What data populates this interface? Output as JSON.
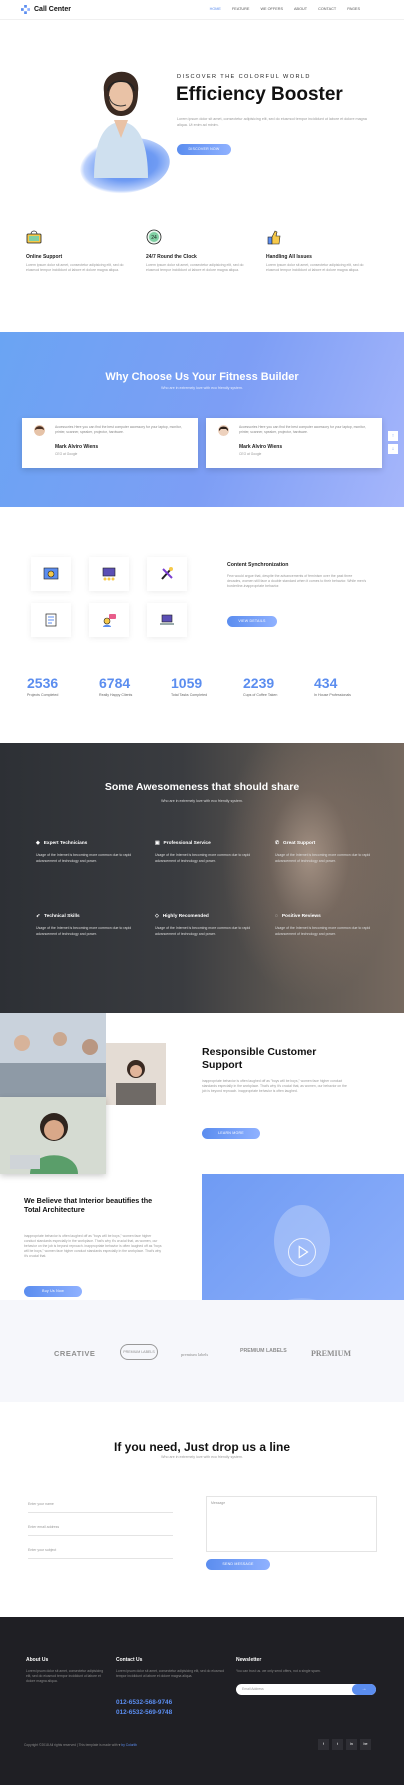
{
  "header": {
    "logo": "Call Center",
    "nav": [
      "HOME",
      "FEATURE",
      "WE OFFERS",
      "ABOUT",
      "CONTACT",
      "PAGES"
    ]
  },
  "hero": {
    "eyebrow": "DISCOVER THE COLORFUL WORLD",
    "title": "Efficiency Booster",
    "text": "Lorem ipsum dolor sit amet, consectetur adipisicing elit, sed do eiusmod tempor incididunt ut labore et dolore magna aliqua. Ut enim ad minim.",
    "button": "DISCOVER NOW"
  },
  "features": [
    {
      "title": "Online Support",
      "text": "Lorem ipsum dolor sit amet, consectetur adipisicing elit, sed do eiusmod tempor incididunt ut labore et dolore magna aliqua."
    },
    {
      "title": "24/7 Round the Clock",
      "text": "Lorem ipsum dolor sit amet, consectetur adipisicing elit, sed do eiusmod tempor incididunt ut labore et dolore magna aliqua."
    },
    {
      "title": "Handling All Issues",
      "text": "Lorem ipsum dolor sit amet, consectetur adipisicing elit, sed do eiusmod tempor incididunt ut labore et dolore magna aliqua."
    }
  ],
  "why": {
    "title": "Why Choose Us Your Fitness Builder",
    "subtitle": "Who are in extremely love with eco friendly system.",
    "cards": [
      {
        "quote": "Accessories Here you can find the best computer accessory for your laptop, monitor, printer, scanner, speaker, projector, hardware.",
        "name": "Mark Alviro Wiens",
        "role": "CEO at Google"
      },
      {
        "quote": "Accessories Here you can find the best computer accessory for your laptop, monitor, printer, scanner, speaker, projector, hardware.",
        "name": "Mark Alviro Wiens",
        "role": "CEO at Google"
      }
    ]
  },
  "services": {
    "title": "Content Synchronization",
    "text": "Few would argue that, despite the advancements of feminism over the past three decades, women still face a double standard when it comes to their behavior. While men's borderline-inappropriate behavior.",
    "button": "VIEW DETAILS",
    "stats": [
      {
        "value": "2536",
        "label": "Projects Completed"
      },
      {
        "value": "6784",
        "label": "Really Happy Clients"
      },
      {
        "value": "1059",
        "label": "Total Tasks Completed"
      },
      {
        "value": "2239",
        "label": "Cups of Coffee Taken"
      },
      {
        "value": "434",
        "label": "In House Professionals"
      }
    ]
  },
  "awesome": {
    "title": "Some Awesomeness that should share",
    "subtitle": "Who are in extremely love with eco friendly system.",
    "items": [
      {
        "icon": "user-icon",
        "title": "Expert Technicians",
        "text": "Usage of the Internet is becoming more common due to rapid advancement of technology and power."
      },
      {
        "icon": "license-icon",
        "title": "Professional Service",
        "text": "Usage of the Internet is becoming more common due to rapid advancement of technology and power."
      },
      {
        "icon": "phone-icon",
        "title": "Great Support",
        "text": "Usage of the Internet is becoming more common due to rapid advancement of technology and power."
      },
      {
        "icon": "rocket-icon",
        "title": "Technical Skills",
        "text": "Usage of the Internet is becoming more common due to rapid advancement of technology and power."
      },
      {
        "icon": "diamond-icon",
        "title": "Highly Recomended",
        "text": "Usage of the Internet is becoming more common due to rapid advancement of technology and power."
      },
      {
        "icon": "bubble-icon",
        "title": "Positive Reviews",
        "text": "Usage of the Internet is becoming more common due to rapid advancement of technology and power."
      }
    ]
  },
  "responsible": {
    "title": "Responsible Customer Support",
    "text": "inappropriate behavior is often laughed off as \"boys will be boys,\" women face higher conduct standards especially in the workplace. That's why it's crucial that, as women, our behavior on the job is beyond reproach. inappropriate behavior is often laughed.",
    "button": "LEARN MORE"
  },
  "believe": {
    "title": "We Believe that Interior beautifies the Total Architecture",
    "text": "inappropriate behavior is often laughed off as \"boys will be boys,\" women face higher conduct standards especially in the workplace. That's why it's crucial that, as women, our behavior on the job is beyond reproach. inappropriate behavior is often laughed off as \"boys will be boys,\" women face higher conduct standards especially in the workplace. That's why it's crucial that.",
    "button": "Buy Us Now"
  },
  "logos": [
    "CREATIVE",
    "PREMIUM LABELS",
    "premium labels",
    "PREMIUM LABELS",
    "PREMIUM"
  ],
  "contact": {
    "title": "If you need, Just drop us a line",
    "subtitle": "Who are in extremely love with eco friendly system.",
    "name_placeholder": "Enter your name",
    "email_placeholder": "Enter email address",
    "subject_placeholder": "Enter your subject",
    "message_placeholder": "Message",
    "button": "SEND MESSAGE"
  },
  "footer": {
    "about_title": "About Us",
    "about_text": "Lorem ipsum dolor sit amet, consectetur adipisicing elit, sed do eiusmod tempor incididunt ut labore et dolore magna aliqua.",
    "contact_title": "Contact Us",
    "contact_text": "Lorem ipsum dolor sit amet, consectetur adipisicing elit, sed do eiusmod tempor incididunt ut labore et dolore magna aliqua.",
    "phone1": "012-6532-568-9746",
    "phone2": "012-6532-569-9748",
    "newsletter_title": "Newsletter",
    "newsletter_text": "You can trust us. we only send offers, not a single spam.",
    "newsletter_placeholder": "Email Address",
    "copyright": "Copyright ©2018 All rights reserved | This template is made with",
    "copyright_by": "by Colorlib",
    "social": [
      "f",
      "t",
      "in",
      "be"
    ]
  }
}
